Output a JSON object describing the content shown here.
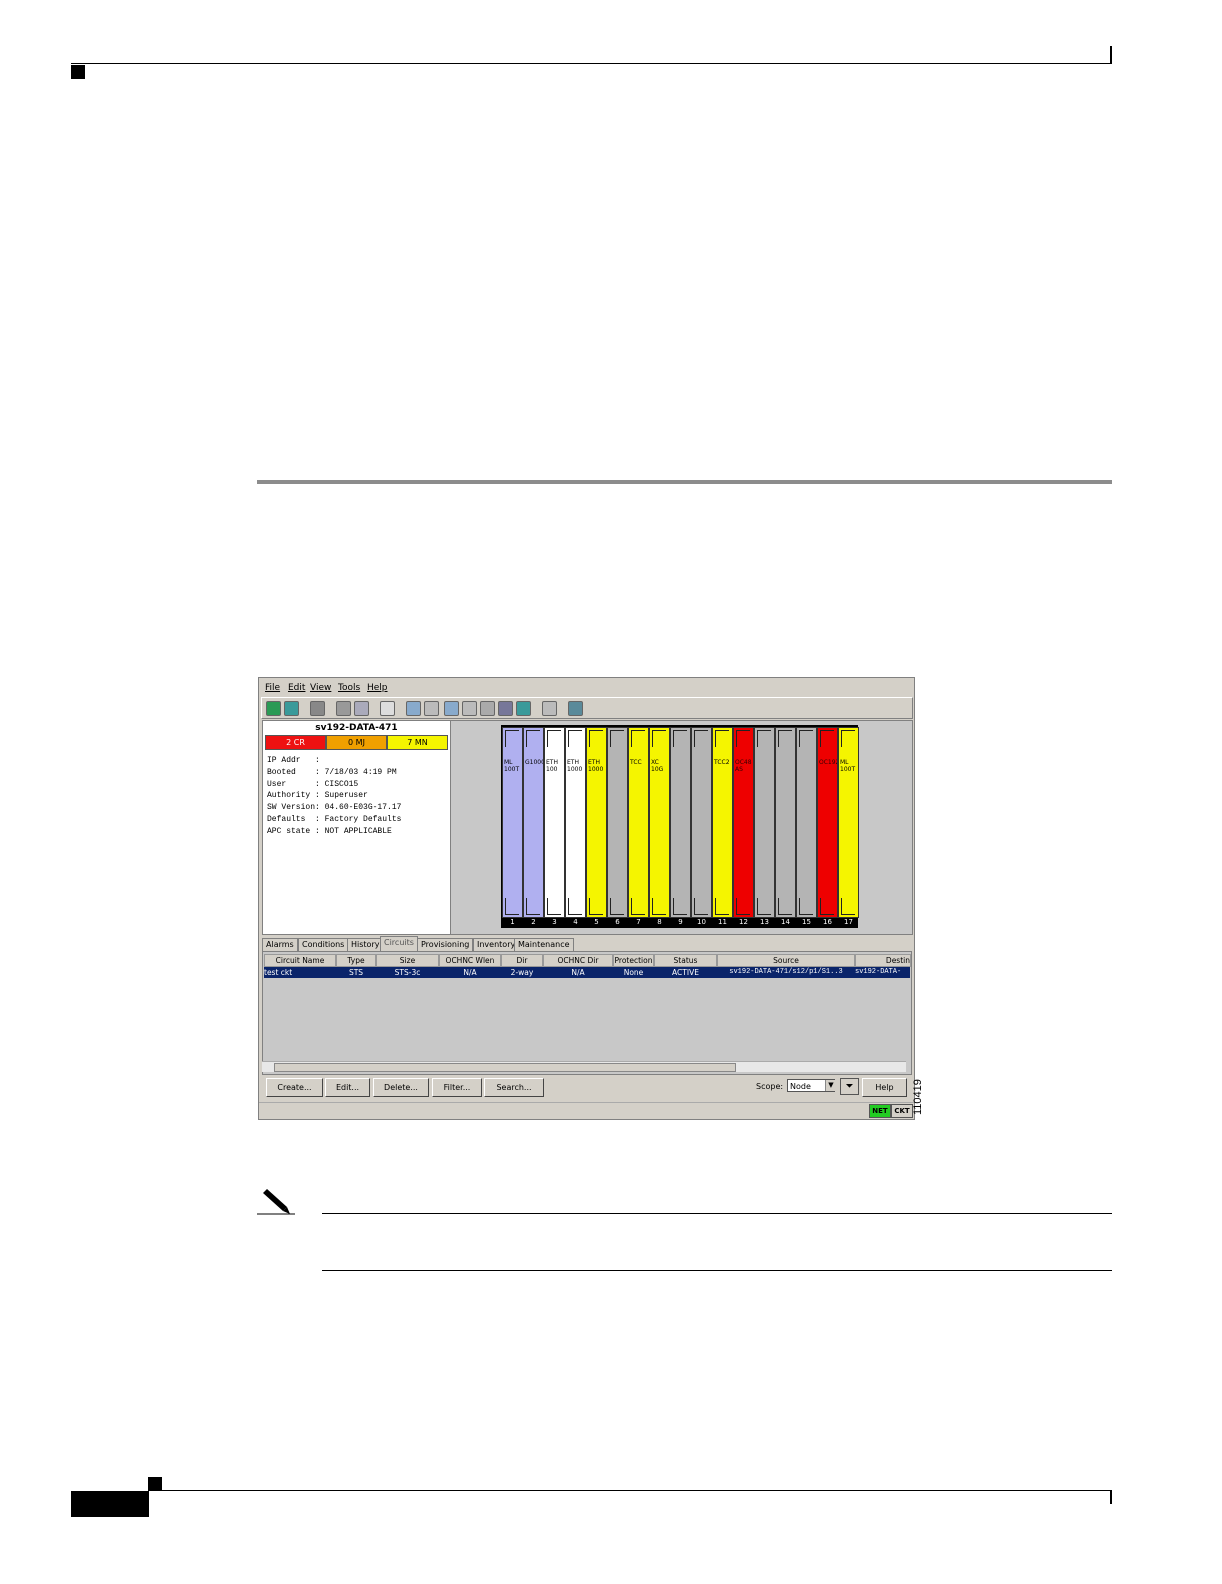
{
  "app": {
    "menu": [
      "File",
      "Edit",
      "View",
      "Tools",
      "Help"
    ],
    "node": {
      "name": "sv192-DATA-471",
      "alarms": {
        "critical": "2 CR",
        "major": "0 MJ",
        "minor": "7 MN"
      },
      "info": "IP Addr   :\nBooted    : 7/18/03 4:19 PM\nUser      : CISCO15\nAuthority : Superuser\nSW Version: 04.60-E03G-17.17\nDefaults  : Factory Defaults\nAPC state : NOT APPLICABLE"
    },
    "shelf": {
      "slots": [
        {
          "num": "1",
          "label": "ML\n100T",
          "color": "#b0b0f0"
        },
        {
          "num": "2",
          "label": "G1000\n",
          "color": "#b0b0f0"
        },
        {
          "num": "3",
          "label": "ETH\n100",
          "color": "#ffffff"
        },
        {
          "num": "4",
          "label": "ETH\n1000",
          "color": "#ffffff"
        },
        {
          "num": "5",
          "label": "ETH\n1000",
          "color": "#f5f500"
        },
        {
          "num": "6",
          "label": "",
          "color": "#b4b4b4"
        },
        {
          "num": "7",
          "label": "TCC",
          "color": "#f5f500"
        },
        {
          "num": "8",
          "label": "XC\n10G",
          "color": "#f5f500"
        },
        {
          "num": "9",
          "label": "",
          "color": "#b4b4b4"
        },
        {
          "num": "10",
          "label": "",
          "color": "#b4b4b4"
        },
        {
          "num": "11",
          "label": "TCC2",
          "color": "#f5f500"
        },
        {
          "num": "12",
          "label": "OC48\nAS",
          "color": "#ee0000"
        },
        {
          "num": "13",
          "label": "",
          "color": "#b4b4b4"
        },
        {
          "num": "14",
          "label": "",
          "color": "#b4b4b4"
        },
        {
          "num": "15",
          "label": "",
          "color": "#b4b4b4"
        },
        {
          "num": "16",
          "label": "OC192",
          "color": "#ee0000"
        },
        {
          "num": "17",
          "label": "ML\n100T",
          "color": "#f5f500"
        }
      ]
    },
    "tabs": [
      "Alarms",
      "Conditions",
      "History",
      "Circuits",
      "Provisioning",
      "Inventory",
      "Maintenance"
    ],
    "active_tab": "Circuits",
    "table": {
      "headers": [
        "Circuit Name",
        "Type",
        "Size",
        "OCHNC Wlen",
        "Dir",
        "OCHNC Dir",
        "Protection",
        "Status",
        "Source",
        "Destin"
      ],
      "row": [
        "test ckt",
        "STS",
        "STS-3c",
        "N/A",
        "2-way",
        "N/A",
        "None",
        "ACTIVE",
        "sv192-DATA-471/s12/p1/S1..3",
        "sv192-DATA-"
      ]
    },
    "buttons": {
      "create": "Create...",
      "edit": "Edit...",
      "delete": "Delete...",
      "filter": "Filter...",
      "search": "Search...",
      "help": "Help"
    },
    "scope": {
      "label": "Scope:",
      "value": "Node"
    },
    "status": {
      "net": "NET",
      "ckt": "CKT"
    }
  },
  "figure_id": "110419",
  "colors": {
    "critical": "#ee1111",
    "major": "#f0a000",
    "minor": "#f5f500",
    "selection": "#0a246a",
    "net_ok": "#22cc22"
  }
}
